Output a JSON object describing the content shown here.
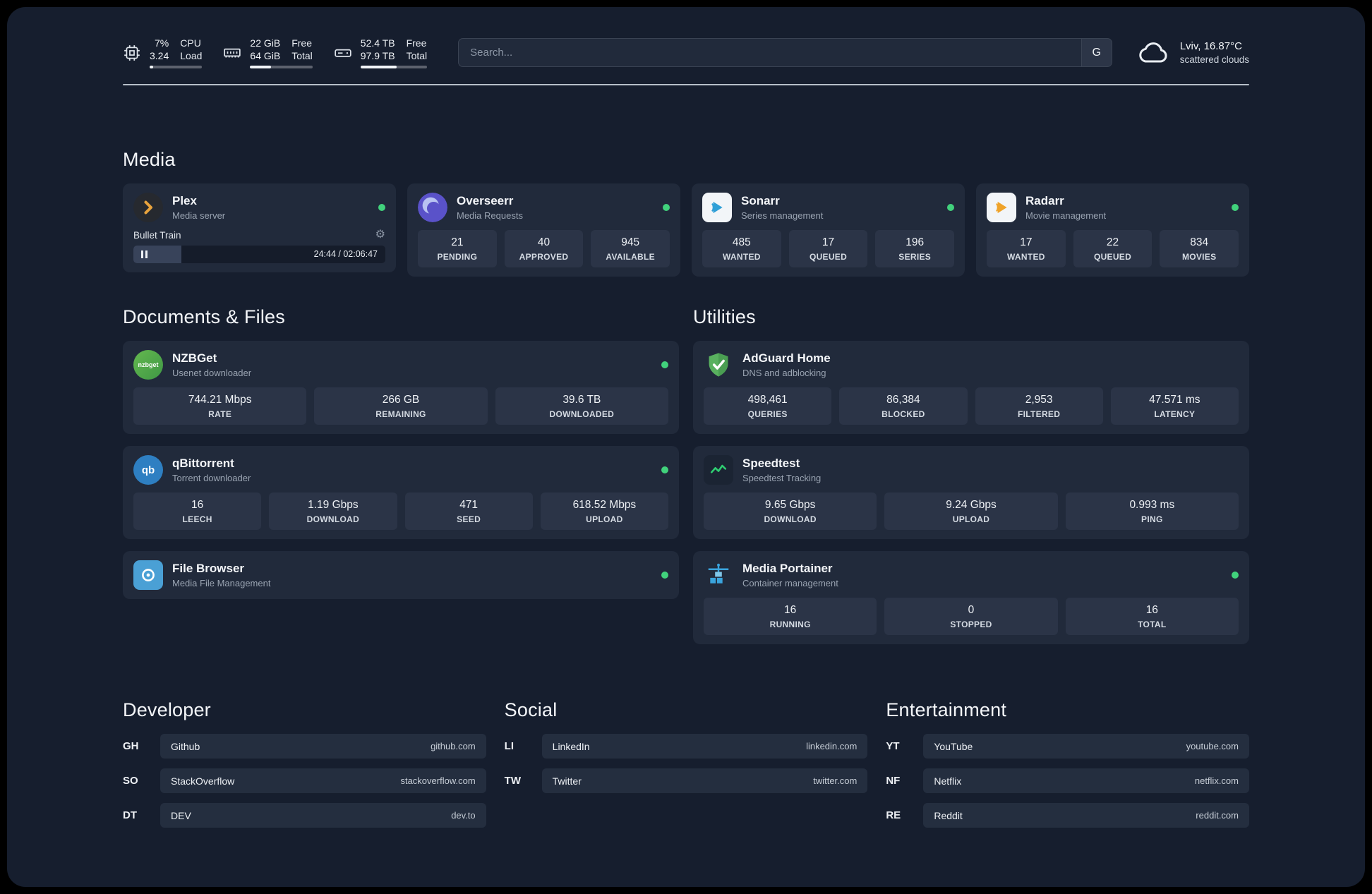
{
  "topbar": {
    "cpu": {
      "value_top": "7%",
      "value_bottom": "3.24",
      "label_top": "CPU",
      "label_bottom": "Load",
      "bar_percent": 7
    },
    "ram": {
      "value_top": "22 GiB",
      "value_bottom": "64 GiB",
      "label_top": "Free",
      "label_bottom": "Total",
      "bar_percent": 34
    },
    "disk": {
      "value_top": "52.4 TB",
      "value_bottom": "97.9 TB",
      "label_top": "Free",
      "label_bottom": "Total",
      "bar_percent": 54
    },
    "search": {
      "placeholder": "Search...",
      "engine_button": "G"
    },
    "weather": {
      "location": "Lviv, 16.87°C",
      "condition": "scattered clouds"
    }
  },
  "media": {
    "title": "Media",
    "plex": {
      "title": "Plex",
      "subtitle": "Media server",
      "status": "online",
      "now_playing": {
        "track": "Bullet Train",
        "time": "24:44 / 02:06:47",
        "progress_percent": 19
      }
    },
    "overseerr": {
      "title": "Overseerr",
      "subtitle": "Media Requests",
      "status": "online",
      "stats": [
        {
          "value": "21",
          "label": "PENDING"
        },
        {
          "value": "40",
          "label": "APPROVED"
        },
        {
          "value": "945",
          "label": "AVAILABLE"
        }
      ]
    },
    "sonarr": {
      "title": "Sonarr",
      "subtitle": "Series management",
      "status": "online",
      "stats": [
        {
          "value": "485",
          "label": "WANTED"
        },
        {
          "value": "17",
          "label": "QUEUED"
        },
        {
          "value": "196",
          "label": "SERIES"
        }
      ]
    },
    "radarr": {
      "title": "Radarr",
      "subtitle": "Movie management",
      "status": "online",
      "stats": [
        {
          "value": "17",
          "label": "WANTED"
        },
        {
          "value": "22",
          "label": "QUEUED"
        },
        {
          "value": "834",
          "label": "MOVIES"
        }
      ]
    }
  },
  "documents": {
    "title": "Documents & Files",
    "nzbget": {
      "title": "NZBGet",
      "subtitle": "Usenet downloader",
      "status": "online",
      "icon_text": "nzbget",
      "stats": [
        {
          "value": "744.21 Mbps",
          "label": "RATE"
        },
        {
          "value": "266 GB",
          "label": "REMAINING"
        },
        {
          "value": "39.6 TB",
          "label": "DOWNLOADED"
        }
      ]
    },
    "qbittorrent": {
      "title": "qBittorrent",
      "subtitle": "Torrent downloader",
      "status": "online",
      "icon_text": "qb",
      "stats": [
        {
          "value": "16",
          "label": "LEECH"
        },
        {
          "value": "1.19 Gbps",
          "label": "DOWNLOAD"
        },
        {
          "value": "471",
          "label": "SEED"
        },
        {
          "value": "618.52 Mbps",
          "label": "UPLOAD"
        }
      ]
    },
    "filebrowser": {
      "title": "File Browser",
      "subtitle": "Media File Management",
      "status": "online"
    }
  },
  "utilities": {
    "title": "Utilities",
    "adguard": {
      "title": "AdGuard Home",
      "subtitle": "DNS and adblocking",
      "stats": [
        {
          "value": "498,461",
          "label": "QUERIES"
        },
        {
          "value": "86,384",
          "label": "BLOCKED"
        },
        {
          "value": "2,953",
          "label": "FILTERED"
        },
        {
          "value": "47.571 ms",
          "label": "LATENCY"
        }
      ]
    },
    "speedtest": {
      "title": "Speedtest",
      "subtitle": "Speedtest Tracking",
      "stats": [
        {
          "value": "9.65 Gbps",
          "label": "DOWNLOAD"
        },
        {
          "value": "9.24 Gbps",
          "label": "UPLOAD"
        },
        {
          "value": "0.993 ms",
          "label": "PING"
        }
      ]
    },
    "portainer": {
      "title": "Media Portainer",
      "subtitle": "Container management",
      "status": "online",
      "stats": [
        {
          "value": "16",
          "label": "RUNNING"
        },
        {
          "value": "0",
          "label": "STOPPED"
        },
        {
          "value": "16",
          "label": "TOTAL"
        }
      ]
    }
  },
  "bookmarks": [
    {
      "title": "Developer",
      "links": [
        {
          "abbr": "GH",
          "name": "Github",
          "url": "github.com"
        },
        {
          "abbr": "SO",
          "name": "StackOverflow",
          "url": "stackoverflow.com"
        },
        {
          "abbr": "DT",
          "name": "DEV",
          "url": "dev.to"
        }
      ]
    },
    {
      "title": "Social",
      "links": [
        {
          "abbr": "LI",
          "name": "LinkedIn",
          "url": "linkedin.com"
        },
        {
          "abbr": "TW",
          "name": "Twitter",
          "url": "twitter.com"
        }
      ]
    },
    {
      "title": "Entertainment",
      "links": [
        {
          "abbr": "YT",
          "name": "YouTube",
          "url": "youtube.com"
        },
        {
          "abbr": "NF",
          "name": "Netflix",
          "url": "netflix.com"
        },
        {
          "abbr": "RE",
          "name": "Reddit",
          "url": "reddit.com"
        }
      ]
    }
  ],
  "colors": {
    "background": "#161e2e",
    "card": "#212a3b",
    "stat_tile": "#2b3447",
    "status_green": "#41d27c"
  }
}
